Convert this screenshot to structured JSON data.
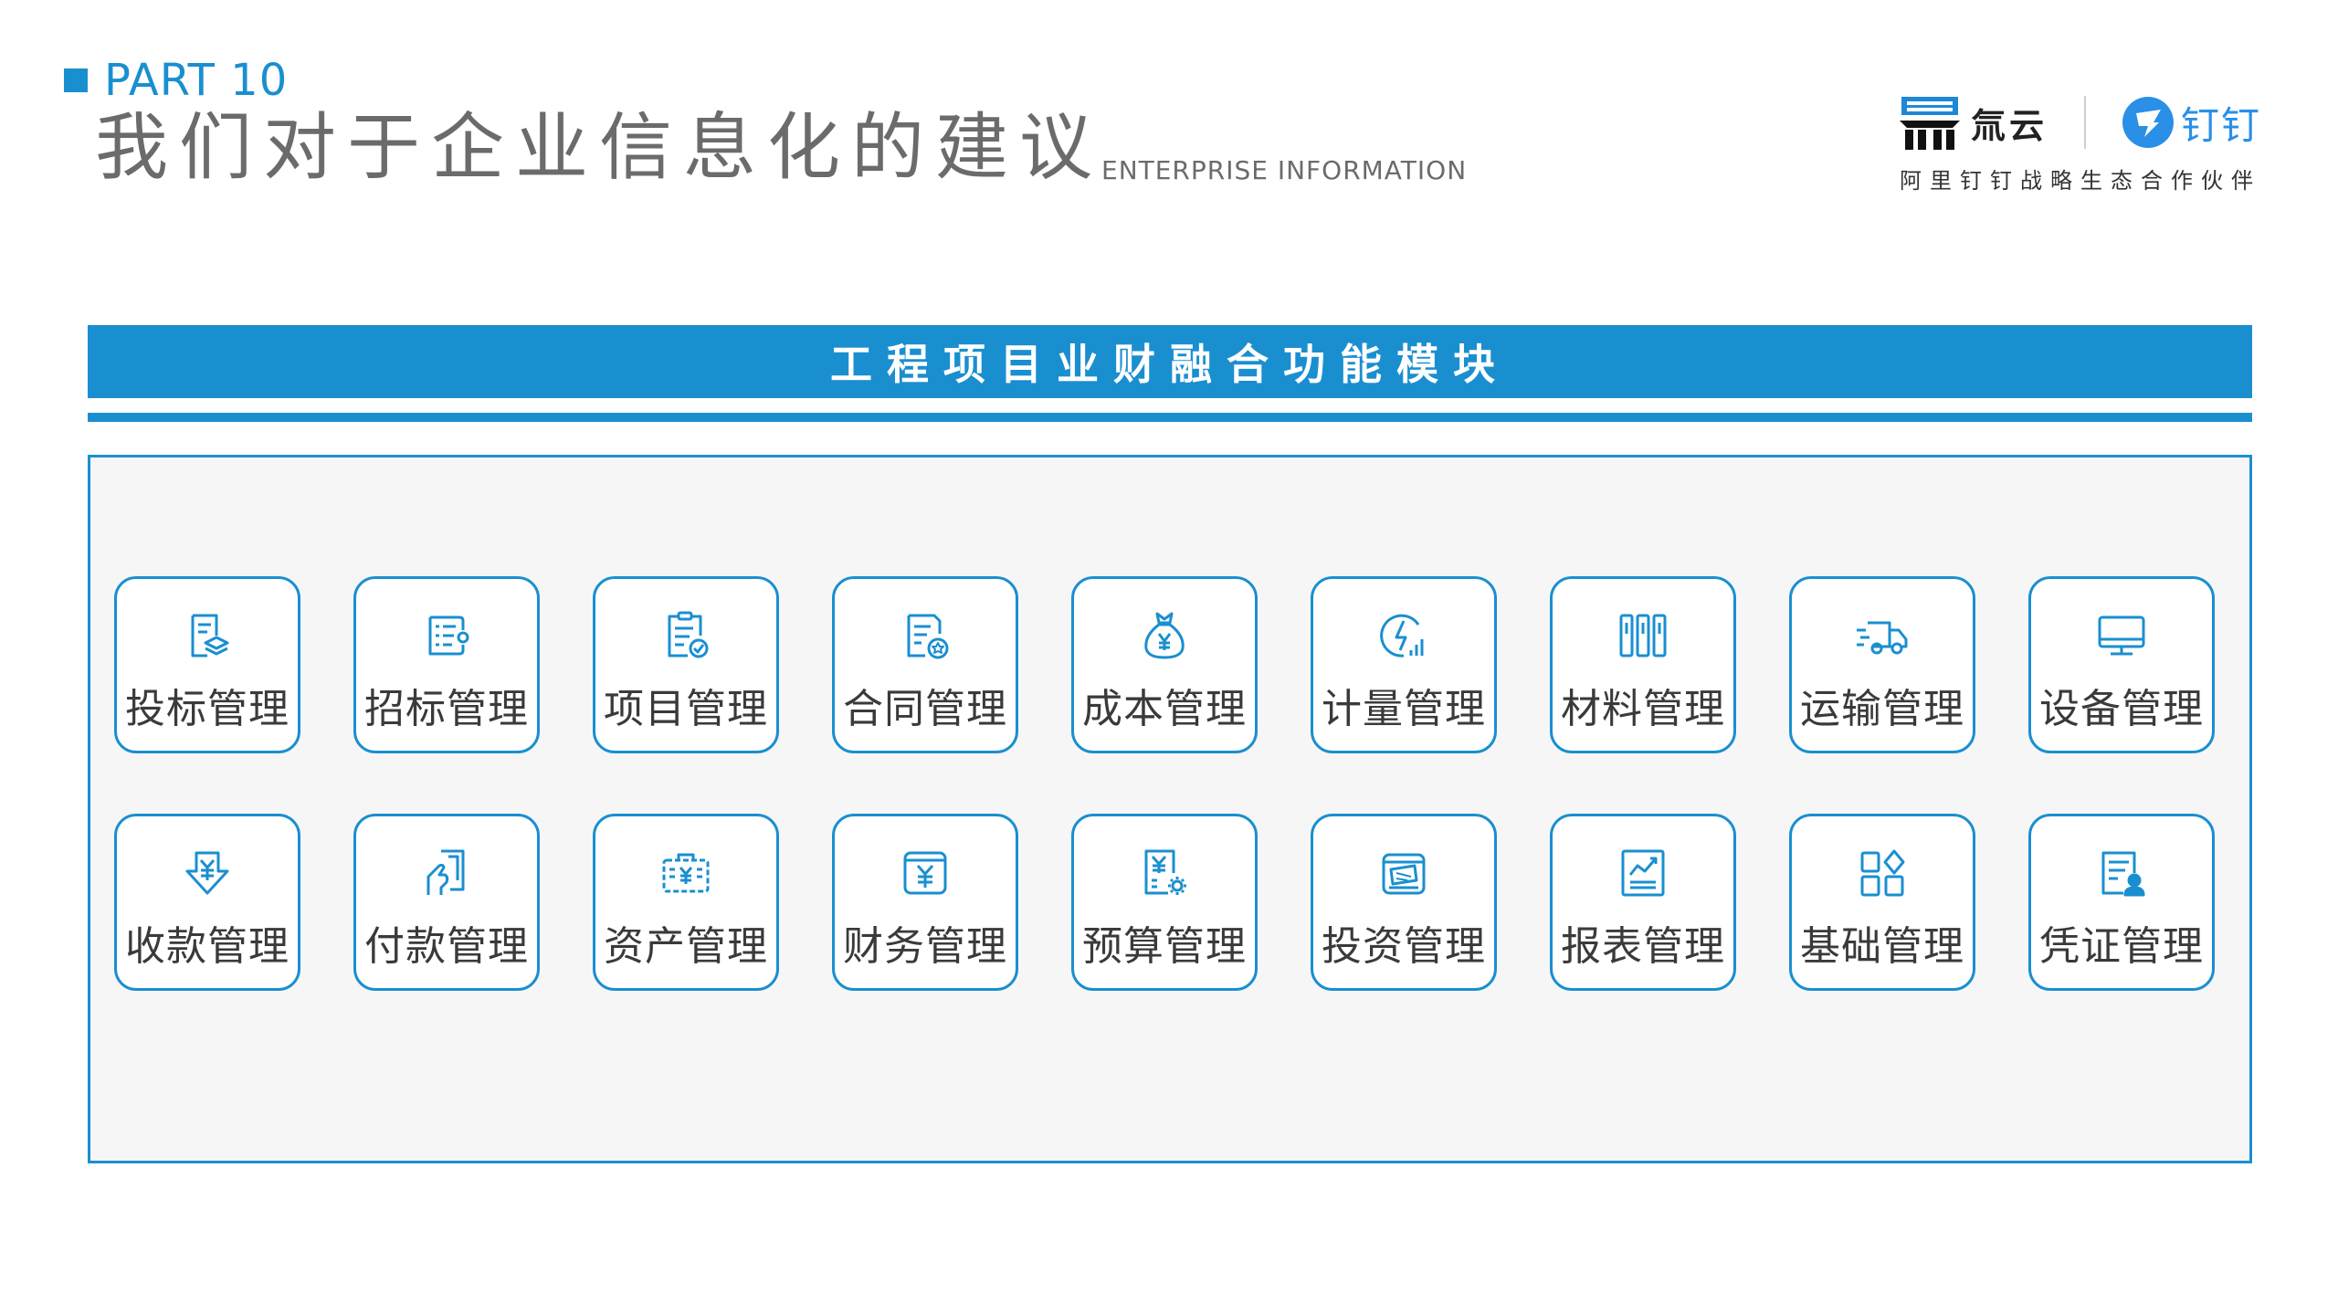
{
  "header": {
    "part": "PART 10",
    "title": "我们对于企业信息化的建议",
    "subtitle": "ENTERPRISE INFORMATION"
  },
  "logo": {
    "brand_a": "氚云",
    "brand_b": "钉钉",
    "caption": "阿里钉钉战略生态合作伙伴"
  },
  "banner": {
    "title": "工程项目业财融合功能模块"
  },
  "colors": {
    "accent": "#1a8fd0",
    "title_gray": "#6b6b6b",
    "panel_bg": "#f6f6f6"
  },
  "modules": [
    {
      "label": "投标管理",
      "icon": "bid-document-icon"
    },
    {
      "label": "招标管理",
      "icon": "tender-list-icon"
    },
    {
      "label": "项目管理",
      "icon": "project-checklist-icon"
    },
    {
      "label": "合同管理",
      "icon": "contract-seal-icon"
    },
    {
      "label": "成本管理",
      "icon": "money-bag-icon"
    },
    {
      "label": "计量管理",
      "icon": "measure-chart-icon"
    },
    {
      "label": "材料管理",
      "icon": "material-binders-icon"
    },
    {
      "label": "运输管理",
      "icon": "delivery-truck-icon"
    },
    {
      "label": "设备管理",
      "icon": "monitor-device-icon"
    },
    {
      "label": "收款管理",
      "icon": "receive-yen-icon"
    },
    {
      "label": "付款管理",
      "icon": "payment-hand-icon"
    },
    {
      "label": "资产管理",
      "icon": "asset-briefcase-icon"
    },
    {
      "label": "财务管理",
      "icon": "finance-wallet-icon"
    },
    {
      "label": "预算管理",
      "icon": "budget-gear-icon"
    },
    {
      "label": "投资管理",
      "icon": "investment-card-icon"
    },
    {
      "label": "报表管理",
      "icon": "report-chart-icon"
    },
    {
      "label": "基础管理",
      "icon": "basic-grid-icon"
    },
    {
      "label": "凭证管理",
      "icon": "voucher-user-icon"
    }
  ]
}
